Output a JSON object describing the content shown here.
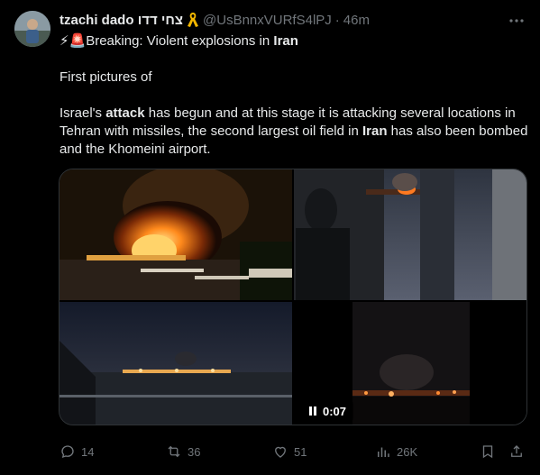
{
  "author": {
    "name": "tzachi dado צחי דדו",
    "handle": "@UsBnnxVURfS4lPJ",
    "separator": "·",
    "time": "46m"
  },
  "tweet": {
    "line1_emoji": "⚡🚨",
    "line1_pre": "Breaking: Violent explosions in ",
    "line1_bold": "Iran",
    "para2": "First pictures of",
    "para3_a": "Israel's ",
    "para3_b": "attack",
    "para3_c": " has begun and at this stage it is attacking several locations in Tehran with missiles, the second largest oil field in ",
    "para3_d": "Iran",
    "para3_e": " has also been bombed and the Khomeini airport."
  },
  "media": {
    "video_duration": "0:07"
  },
  "actions": {
    "replies": "14",
    "reposts": "36",
    "likes": "51",
    "views": "26K"
  },
  "colors": {
    "background": "#000000",
    "text": "#e7e9ea",
    "muted": "#71767b",
    "border": "#2f3336",
    "ribbon": "#f5b800"
  }
}
